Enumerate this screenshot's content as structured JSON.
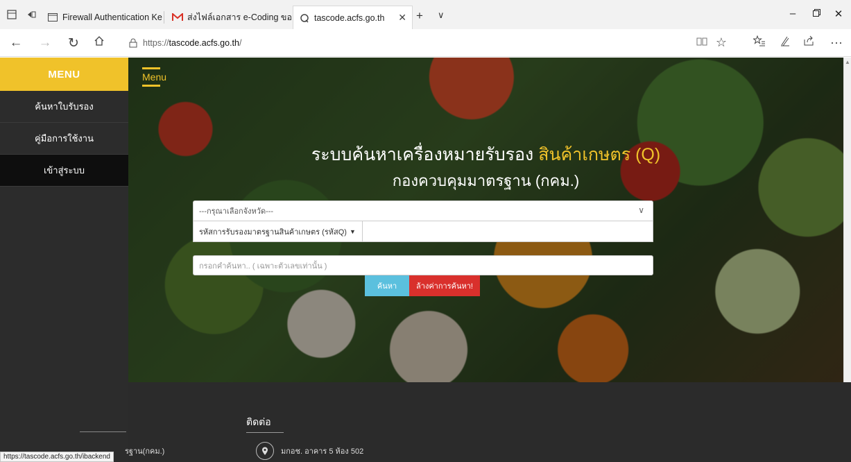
{
  "browser": {
    "tabs": [
      {
        "label": "Firewall Authentication Keep",
        "icon": "page-icon"
      },
      {
        "label": "ส่งไฟล์เอกสาร e-Coding ของต",
        "icon": "gmail-icon"
      },
      {
        "label": "tascode.acfs.go.th",
        "icon": "loading-icon"
      }
    ],
    "url_prefix": "https://",
    "url_host": "tascode.acfs.go.th",
    "url_suffix": "/",
    "status_url": "https://tascode.acfs.go.th/ibackend"
  },
  "sidebar": {
    "menu_title": "MENU",
    "items": [
      {
        "label": "ค้นหาใบรับรอง"
      },
      {
        "label": "คู่มือการใช้งาน"
      },
      {
        "label": "เข้าสู่ระบบ"
      }
    ]
  },
  "hero": {
    "menu_label": "Menu",
    "title_main": "ระบบค้นหาเครื่องหมายรับรอง ",
    "title_accent": "สินค้าเกษตร (Q)",
    "subtitle": "กองควบคุมมาตรฐาน (กคม.)",
    "province_placeholder": "---กรุณาเลือกจังหวัด---",
    "code_type": "รหัสการรับรองมาตรฐานสินค้าเกษตร (รหัสQ)",
    "search_placeholder": "กรอกคำค้นหา.. ( เฉพาะตัวเลขเท่านั้น )",
    "search_button": "ค้นหา",
    "clear_button": "ล้างค่าการค้นหา!"
  },
  "footer": {
    "contact_heading": "ติดต่อ",
    "address": "มกอช. อาคาร 5 ห้อง 502",
    "left_text": "รฐาน(กคม.)"
  },
  "colors": {
    "accent": "#f0c22a",
    "search_button": "#5bc0de",
    "clear_button": "#d9302c",
    "sidebar_bg": "#2c2c2c"
  }
}
